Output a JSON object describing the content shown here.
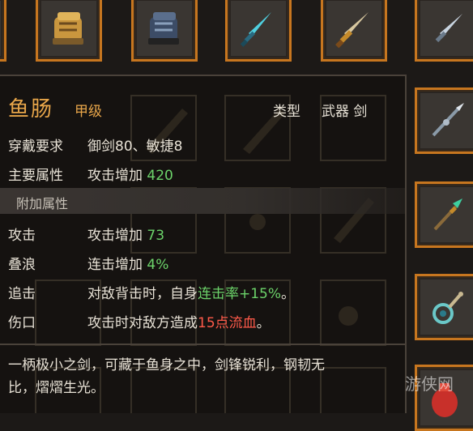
{
  "inventory": {
    "top_row": [
      {
        "icon": "gauntlet-gold-icon"
      },
      {
        "icon": "gauntlet-dark-icon"
      },
      {
        "icon": "sword-cyan-icon"
      },
      {
        "icon": "sword-gold-icon"
      },
      {
        "icon": "sword-silver-icon"
      }
    ],
    "right_column": [
      {
        "icon": "spear-silver-icon"
      },
      {
        "icon": "spear-jade-icon"
      },
      {
        "icon": "amulet-teal-icon"
      },
      {
        "icon": "red-vase-icon"
      }
    ]
  },
  "tooltip": {
    "name": "鱼肠",
    "grade": "甲级",
    "type_label": "类型",
    "type_value": "武器 剑",
    "requirement": {
      "key": "穿戴要求",
      "value": "御剑80、敏捷8"
    },
    "main_attr": {
      "key": "主要属性",
      "prefix": "攻击增加 ",
      "number": "420"
    },
    "extra_section_title": "附加属性",
    "extras": [
      {
        "key": "攻击",
        "prefix": "攻击增加 ",
        "highlight": "73",
        "suffix": ""
      },
      {
        "key": "叠浪",
        "prefix": "连击增加 ",
        "highlight": "4%",
        "suffix": ""
      },
      {
        "key": "追击",
        "prefix": "对敌背击时，自身",
        "highlight": "连击率+15%",
        "suffix": "。"
      },
      {
        "key": "伤口",
        "prefix": "攻击时对敌方造成",
        "highlight": "15点流血",
        "suffix": "。"
      }
    ],
    "description": "一柄极小之剑，可藏于鱼身之中，剑锋锐利，钢韧无比，熠熠生光。"
  },
  "watermark": "游侠网",
  "colors": {
    "slot_border": "#c7761f",
    "name": "#e8a64a",
    "green": "#6cd36a",
    "red": "#ff5a4a"
  }
}
